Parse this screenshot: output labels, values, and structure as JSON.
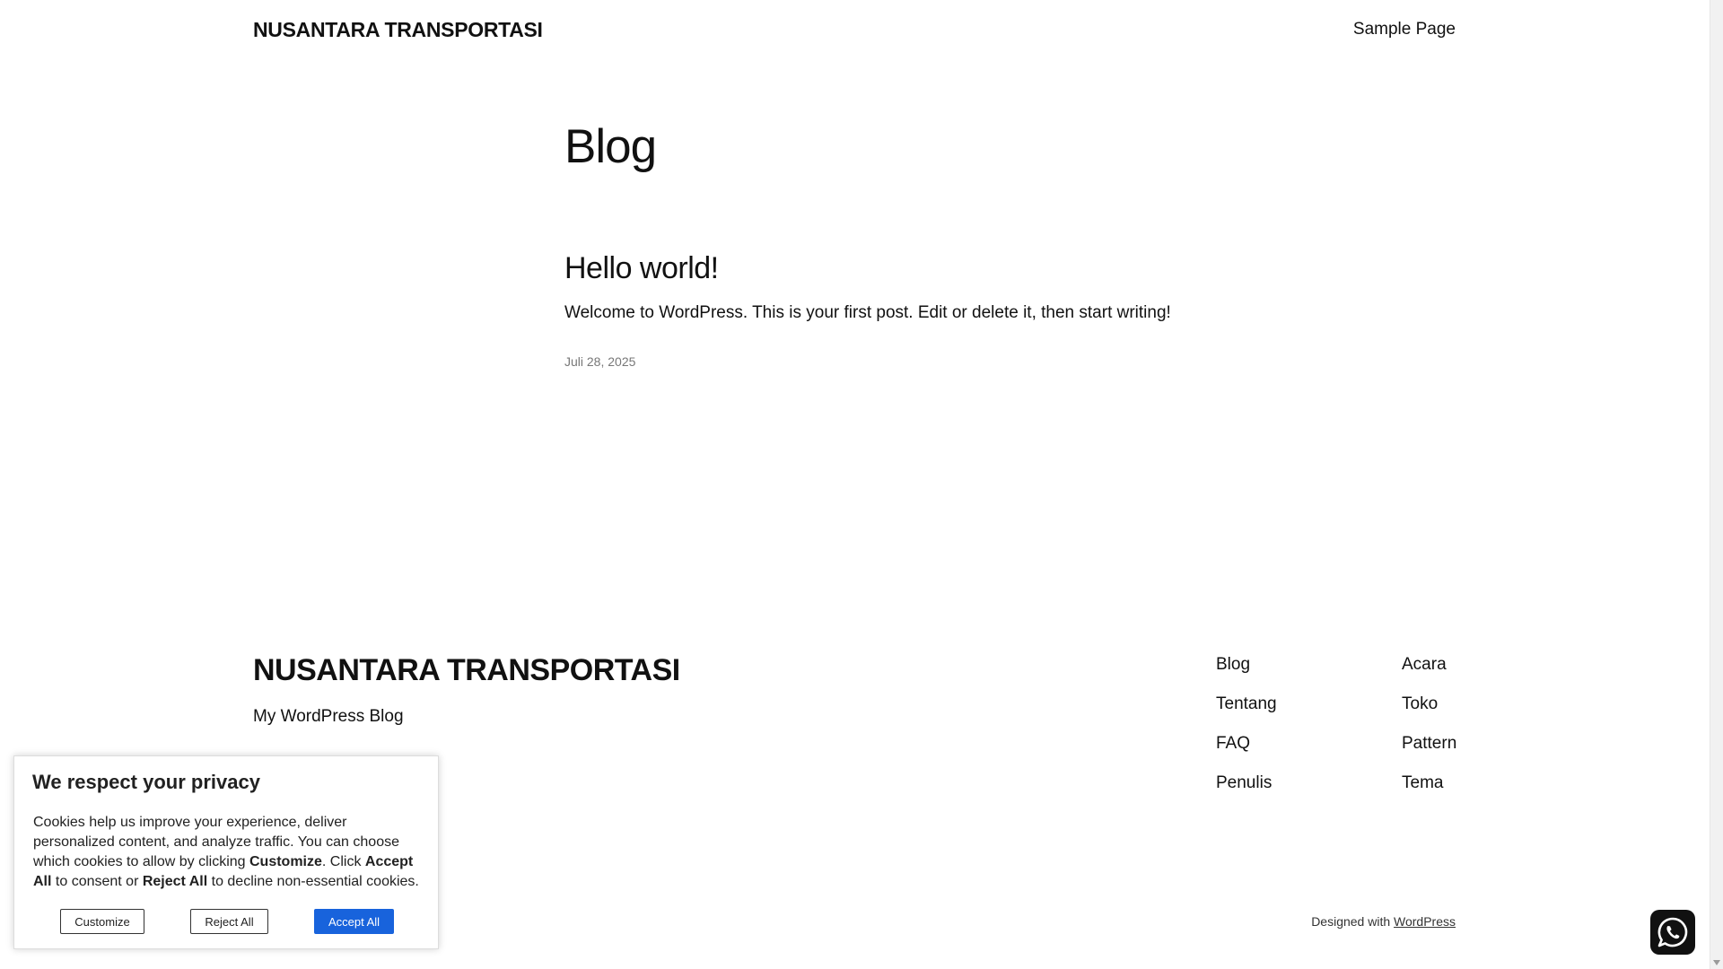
{
  "header": {
    "site_title": "NUSANTARA TRANSPORTASI",
    "nav_link": "Sample Page"
  },
  "main": {
    "heading": "Blog",
    "post": {
      "title": "Hello world!",
      "excerpt": "Welcome to WordPress. This is your first post. Edit or delete it, then start writing!",
      "date": "Juli 28, 2025"
    }
  },
  "footer": {
    "site_title": "NUSANTARA TRANSPORTASI",
    "tagline": "My WordPress Blog",
    "links_col1": [
      "Blog",
      "Tentang",
      "FAQ",
      "Penulis"
    ],
    "links_col2": [
      "Acara",
      "Toko",
      "Pattern",
      "Tema"
    ],
    "credit_prefix": "Designed with",
    "credit_link": "WordPress"
  },
  "cookie_banner": {
    "title": "We respect your privacy",
    "text_1": "Cookies help us improve your experience, deliver personalized content, and analyze traffic. You can choose which cookies to allow by clicking ",
    "bold_customize": "Customize",
    "text_2": ". Click ",
    "bold_accept": "Accept All",
    "text_3": " to consent or ",
    "bold_reject": "Reject All",
    "text_4": " to decline non-essential cookies.",
    "customize_label": "Customize",
    "reject_label": "Reject All",
    "accept_label": "Accept All",
    "accept_color": "#1863dc"
  },
  "floating": {
    "whatsapp_icon": "whatsapp-icon"
  }
}
